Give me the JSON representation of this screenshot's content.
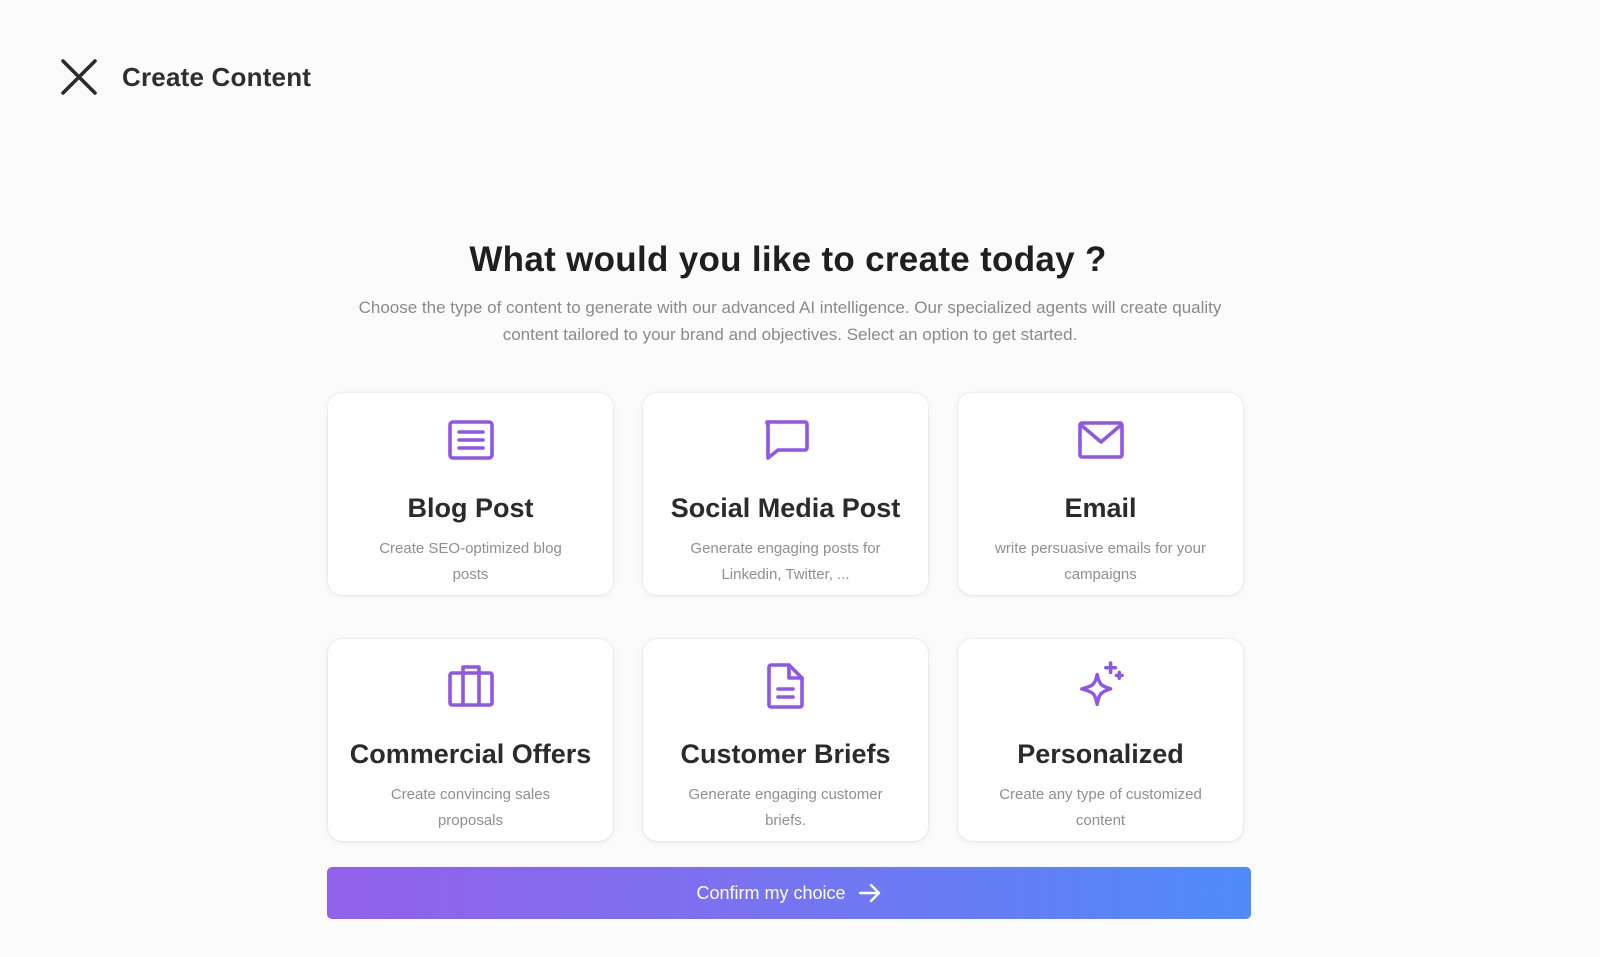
{
  "header": {
    "close_icon": "close-icon",
    "title": "Create Content"
  },
  "hero": {
    "title": "What would you like to create today ?",
    "subtitle": "Choose the type of content to generate with our advanced AI intelligence. Our specialized agents will create quality content tailored to your brand and objectives. Select an option to get started."
  },
  "accent_color": "#8e57e8",
  "cards": [
    {
      "icon": "blog-post-icon",
      "title": "Blog Post",
      "description": "Create SEO-optimized blog posts"
    },
    {
      "icon": "chat-bubble-icon",
      "title": "Social Media Post",
      "description": "Generate engaging posts for Linkedin, Twitter, ..."
    },
    {
      "icon": "envelope-icon",
      "title": "Email",
      "description": "write persuasive emails for your campaigns"
    },
    {
      "icon": "briefcase-icon",
      "title": "Commercial Offers",
      "description": "Create convincing sales proposals"
    },
    {
      "icon": "document-icon",
      "title": "Customer Briefs",
      "description": "Generate engaging customer briefs."
    },
    {
      "icon": "sparkles-icon",
      "title": "Personalized",
      "description": "Create any type of customized content"
    }
  ],
  "confirm": {
    "label": "Confirm my choice",
    "icon": "arrow-right-icon"
  }
}
